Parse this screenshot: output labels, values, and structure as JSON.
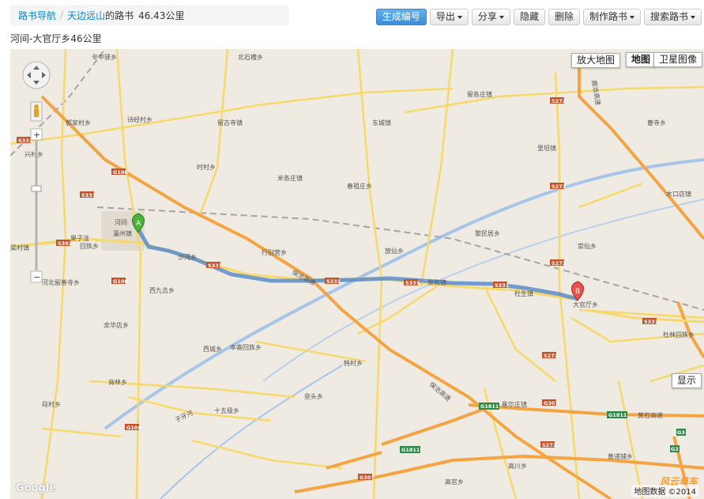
{
  "breadcrumb": {
    "nav_link": "路书导航",
    "separator": "/",
    "author_link": "天边远山",
    "suffix": "的路书",
    "distance": "46.43公里"
  },
  "toolbar": {
    "generate": "生成编号",
    "export": "导出",
    "share": "分享",
    "hide": "隐藏",
    "delete": "删除",
    "make": "制作路书",
    "search": "搜索路书"
  },
  "route_title": "河间-大官厅乡46公里",
  "map": {
    "enlarge": "放大地图",
    "type_map": "地图",
    "type_satellite": "卫星图像",
    "show": "显示",
    "copyright": "地图数据 ©2014",
    "google": "Google",
    "watermark": "风云单车",
    "marker_a": "A",
    "marker_b": "B",
    "zoom_plus": "+",
    "zoom_minus": "−",
    "places": {
      "xinzhongyi": "辛中驿乡",
      "beishicao": "北石槽乡",
      "guodiyu": "郭家村乡",
      "shijingcun": "诗经村乡",
      "liugusi": "留古寺镇",
      "xingcun": "兴村乡",
      "shicun": "时村乡",
      "dongcheng": "东城镇",
      "liugezhuang": "留各庄镇",
      "caosi": "曹寺乡",
      "libaozhen": "里坦镇",
      "migezhuang": "米各庄镇",
      "chunzuzhuang": "春祖庄乡",
      "mukoudian": "木口店镇",
      "hejian": "河间",
      "yingzhou": "瀛州镇",
      "guozizhuang": "果子洼",
      "huizuxiang": "回族乡",
      "liangcun": "梁村镇",
      "shaheqiao": "沙河乡",
      "xingbieying": "行别营乡",
      "fangcunxiang": "放仙乡",
      "liminju": "黎民居乡",
      "chongxian": "崇仙乡",
      "jinghe": "景和镇",
      "dusheng": "杜生镇",
      "daguanting": "大官厅乡",
      "hebeiliu": "河北留善寺乡",
      "xijiuji": "西九吉乡",
      "longhuadian": "龙华店乡",
      "xicheng": "西城乡",
      "benzhaihui": "本斋回族乡",
      "hancun": "韩村乡",
      "shanglin": "商林乡",
      "tutou": "垒头乡",
      "shiwuji": "十五级乡",
      "dingcun": "段村乡",
      "cuierzhuang": "崔尔庄镇",
      "dulin": "杜林回族乡",
      "gaochuan": "高川乡",
      "huangdun": "黄递铺乡",
      "gaoguan": "高官乡",
      "ziyahe": "子牙河",
      "baocang": "保沧高速",
      "huangshi": "黄石高速",
      "langcang": "廊沧高速",
      "baodian": "保沧高速"
    },
    "roads": {
      "s331": "S331",
      "s272": "S272",
      "g106": "G106",
      "s382": "S382",
      "g1811": "G1811",
      "g307": "G307",
      "g3": "G3",
      "g2": "G2"
    }
  }
}
